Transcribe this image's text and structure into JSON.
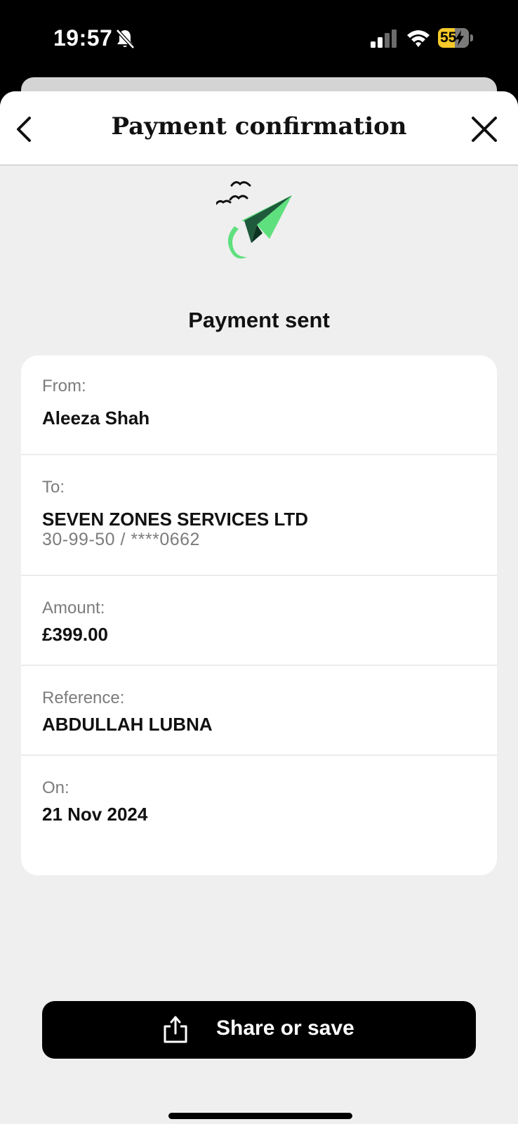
{
  "status_bar": {
    "time": "19:57",
    "battery_level": "55",
    "battery_color": "#f5c92a"
  },
  "header": {
    "title": "Payment confirmation",
    "back_icon": "chevron-left-icon",
    "close_icon": "close-icon"
  },
  "illustration": {
    "icon": "paper-plane-icon",
    "accent": "#5fe07e"
  },
  "status_heading": "Payment sent",
  "details": {
    "from": {
      "label": "From:",
      "value": "Aleeza Shah"
    },
    "to": {
      "label": "To:",
      "value": "SEVEN ZONES SERVICES LTD",
      "account": "30-99-50 / ****0662"
    },
    "amount": {
      "label": "Amount:",
      "value": "£399.00"
    },
    "reference": {
      "label": "Reference:",
      "value": "ABDULLAH LUBNA"
    },
    "date": {
      "label": "On:",
      "value": "21 Nov 2024"
    }
  },
  "share_button": {
    "label": "Share or save",
    "icon": "share-icon"
  }
}
